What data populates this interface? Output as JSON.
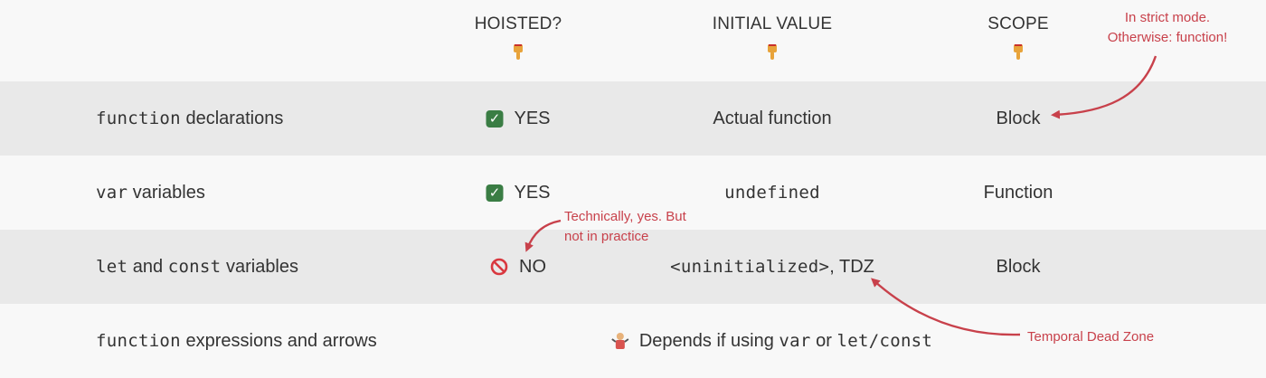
{
  "headers": {
    "hoisted": "HOISTED?",
    "initial_value": "INITIAL VALUE",
    "scope": "SCOPE",
    "pointer_icon": "pointing-down-hand-icon"
  },
  "rows": [
    {
      "code": "function",
      "label_rest": " declarations",
      "hoisted_icon": "check-mark-icon",
      "hoisted": "YES",
      "initial_value": "Actual function",
      "scope": "Block"
    },
    {
      "code": "var",
      "label_rest": " variables",
      "hoisted_icon": "check-mark-icon",
      "hoisted": "YES",
      "initial_value": "undefined",
      "scope": "Function"
    },
    {
      "code_1": "let",
      "label_mid": " and ",
      "code_2": "const",
      "label_rest": " variables",
      "hoisted_icon": "prohibited-icon",
      "hoisted": "NO",
      "initial_value_code": "<uninitialized>",
      "initial_value_rest": ", TDZ",
      "scope": "Block"
    },
    {
      "code": "function",
      "label_rest": " expressions and arrows",
      "depends_icon": "person-shrugging-icon",
      "depends_text": "Depends if using ",
      "depends_code_1": "var",
      "depends_mid": " or ",
      "depends_code_2": "let/const"
    }
  ],
  "notes": {
    "strict_mode_line1": "In strict mode.",
    "strict_mode_line2": "Otherwise: function!",
    "technically_line1": "Technically, yes. But",
    "technically_line2": "not in practice",
    "tdz": "Temporal Dead Zone"
  },
  "colors": {
    "accent": "#c8414b",
    "row_shade": "#e9e9e9",
    "background": "#f8f8f8",
    "check_green": "#3a7d44"
  }
}
